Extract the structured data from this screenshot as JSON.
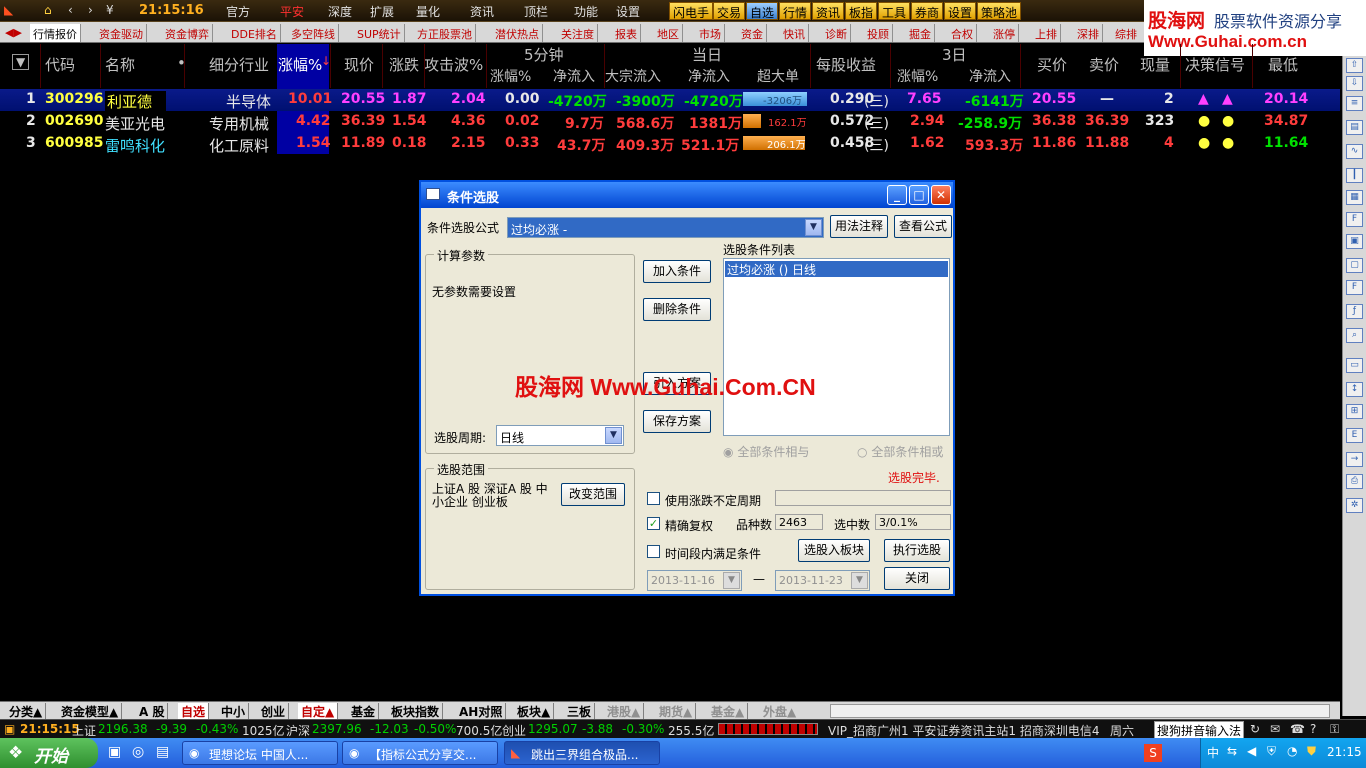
{
  "topbar": {
    "clock": "21:15:16",
    "menus": [
      "官方",
      "平安",
      "深度",
      "扩展",
      "量化",
      "资讯",
      "顶栏",
      "功能",
      "设置"
    ],
    "yellow_tabs": [
      "闪电手",
      "交易",
      "自选",
      "行情",
      "资讯",
      "板指",
      "工具",
      "券商",
      "设置",
      "策略池"
    ]
  },
  "logo": {
    "name": "股海网",
    "slogan": "股票软件资源分享",
    "url": "Www.Guhai.com.cn"
  },
  "feature_tabs": [
    "行情报价",
    "资金驱动",
    "资金博弈",
    "DDE排名",
    "多空阵线",
    "SUP统计",
    "方正股票池",
    "潜伏热点",
    "关注度",
    "报表",
    "地区",
    "市场",
    "资金",
    "快讯",
    "诊断",
    "投顾",
    "掘金",
    "合权",
    "涨停",
    "上排",
    "深排",
    "综排"
  ],
  "headers": {
    "code": "代码",
    "name": "名称",
    "dot": "•",
    "industry": "细分行业",
    "pct": "涨幅%",
    "sort": "↓",
    "price": "现价",
    "change": "涨跌",
    "attack": "攻击波%",
    "grp5": "5分钟",
    "grpday": "当日",
    "grp3": "3日",
    "m5_pct": "涨幅%",
    "m5_flow": "净流入",
    "big_flow": "大宗流入",
    "day_flow": "净流入",
    "super": "超大单",
    "eps": "每股收益",
    "d3_pct": "涨幅%",
    "d3_flow": "净流入",
    "buy": "买价",
    "sell": "卖价",
    "vol": "现量",
    "signal": "决策信号",
    "low": "最低"
  },
  "rows": [
    {
      "idx": "1",
      "code": "300296",
      "name": "利亚德",
      "industry": "半导体",
      "pct": "10.01",
      "price": "20.55",
      "change": "1.87",
      "attack": "2.04",
      "m5_pct": "0.00",
      "m5_flow": "-4720万",
      "big": "-3900万",
      "day_flow": "-4720万",
      "super": "-3206万",
      "super_frac": 1.0,
      "eps": "0.290",
      "eps_tag": "(三)",
      "d3_pct": "7.65",
      "d3_flow": "-6141万",
      "buy": "20.55",
      "sell": "—",
      "vol": "2",
      "low": "20.14"
    },
    {
      "idx": "2",
      "code": "002690",
      "name": "美亚光电",
      "industry": "专用机械",
      "pct": "4.42",
      "price": "36.39",
      "change": "1.54",
      "attack": "4.36",
      "m5_pct": "0.02",
      "m5_flow": "9.7万",
      "big": "568.6万",
      "day_flow": "1381万",
      "super": "162.1万",
      "super_frac": 0.28,
      "eps": "0.572",
      "eps_tag": "(三)",
      "d3_pct": "2.94",
      "d3_flow": "-258.9万",
      "buy": "36.38",
      "sell": "36.39",
      "vol": "323",
      "low": "34.87"
    },
    {
      "idx": "3",
      "code": "600985",
      "name": "雷鸣科化",
      "industry": "化工原料",
      "pct": "1.54",
      "price": "11.89",
      "change": "0.18",
      "attack": "2.15",
      "m5_pct": "0.33",
      "m5_flow": "43.7万",
      "big": "409.3万",
      "day_flow": "521.1万",
      "super": "206.1万",
      "super_frac": 1.0,
      "eps": "0.458",
      "eps_tag": "(三)",
      "d3_pct": "1.62",
      "d3_flow": "593.3万",
      "buy": "11.86",
      "sell": "11.88",
      "vol": "4",
      "low": "11.64"
    }
  ],
  "dialog": {
    "title": "条件选股",
    "formula_label": "条件选股公式",
    "formula_value": "过均必涨 -",
    "btn_usage": "用法注释",
    "btn_view": "查看公式",
    "params_title": "计算参数",
    "params_text": "无参数需要设置",
    "btn_add": "加入条件",
    "btn_del": "删除条件",
    "btn_import": "引入方案",
    "btn_save": "保存方案",
    "list_title": "选股条件列表",
    "list_item": "过均必涨  () 日线",
    "period_label": "选股周期:",
    "period_value": "日线",
    "radio_and": "全部条件相与",
    "radio_or": "全部条件相或",
    "done": "选股完毕.",
    "range_title": "选股范围",
    "range_text": "上证A 股 深证A 股 中小企业 创业板",
    "btn_range": "改变范围",
    "chk_unfixed": "使用涨跌不定周期",
    "chk_fuquan": "精确复权",
    "count_label": "品种数",
    "count_value": "2463",
    "sel_label": "选中数",
    "sel_value": "3/0.1%",
    "chk_time": "时间段内满足条件",
    "btn_to_block": "选股入板块",
    "btn_exec": "执行选股",
    "date_from": "2013-11-16",
    "date_to": "2013-11-23",
    "dash": "—",
    "btn_close": "关闭"
  },
  "watermark": "股海网 Www.Guhai.Com.CN",
  "bottom_tabs": [
    "分类▲",
    "资金模型▲",
    "A 股",
    "自选",
    "中小",
    "创业",
    "自定▲",
    "基金",
    "板块指数",
    "AH对照",
    "板块▲",
    "三板",
    "港股▲",
    "期货▲",
    "基金▲",
    "外盘▲"
  ],
  "status": {
    "time": "21:15:15",
    "sh": "上证",
    "sh_val": "2196.38",
    "sh_chg": "-9.39",
    "sh_pct": "-0.43%",
    "sh_amt": "1025亿",
    "hs": "沪深",
    "hs_val": "2397.96",
    "hs_chg": "-12.03",
    "hs_pct": "-0.50%",
    "hs_amt": "700.5亿",
    "cy": "创业",
    "cy_val": "1295.07",
    "cy_chg": "-3.88",
    "cy_pct": "-0.30%",
    "cy_amt": "255.5亿",
    "server": "VIP_招商广州1 平安证券资讯主站1 招商深圳电信4",
    "weekday": "周六",
    "ime": "搜狗拼音输入法"
  },
  "taskbar": {
    "start": "开始",
    "tasks": [
      "理想论坛 中国人...",
      "【指标公式分享交...",
      "跳出三界组合极品..."
    ],
    "clock": "21:15"
  }
}
